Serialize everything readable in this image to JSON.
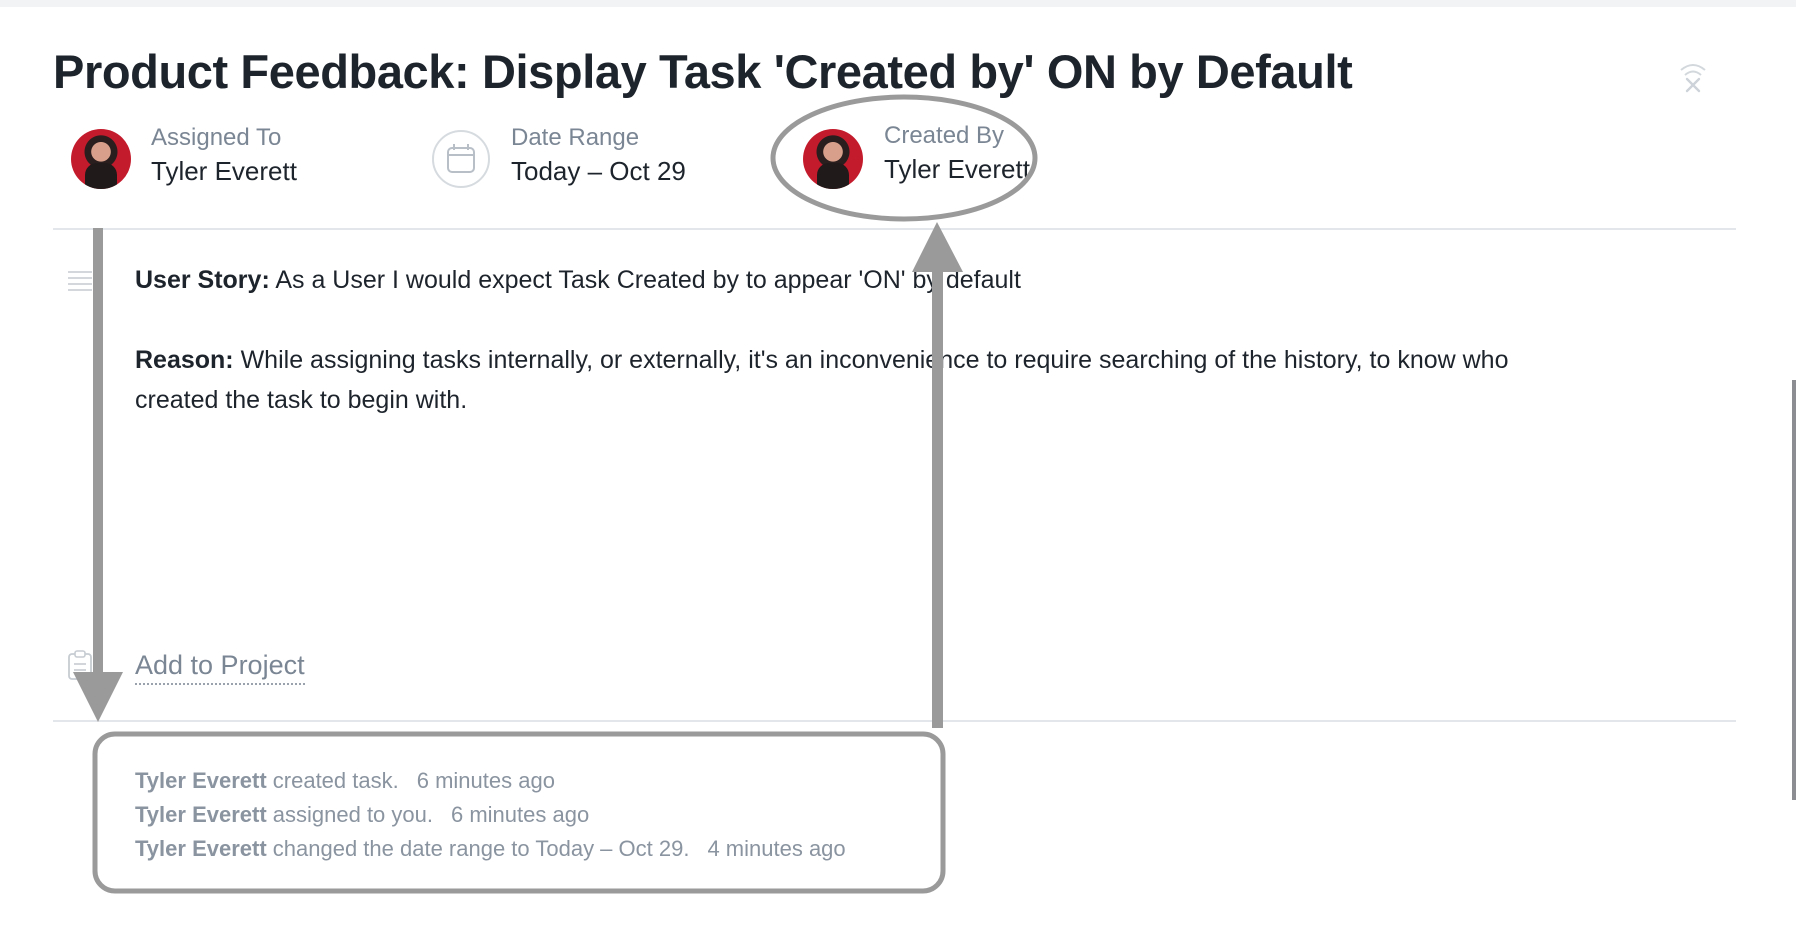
{
  "task": {
    "title": "Product Feedback:  Display Task 'Created by' ON by Default"
  },
  "fields": {
    "assigned_to": {
      "label": "Assigned To",
      "value": "Tyler Everett"
    },
    "date_range": {
      "label": "Date Range",
      "value": "Today – Oct 29"
    },
    "created_by": {
      "label": "Created By",
      "value": "Tyler Everett"
    }
  },
  "description": {
    "story_label": "User Story:",
    "story_text": " As a User I would expect Task Created by to appear 'ON' by default",
    "reason_label": "Reason:",
    "reason_text_1": " While assigning tasks internally, or externally, it's an inconvenience to require searching of the history, to know who",
    "reason_text_2": "created the task to begin with."
  },
  "project": {
    "add_label": "Add to Project"
  },
  "activity": [
    {
      "actor": "Tyler Everett",
      "action": " created task.",
      "time": "6 minutes ago"
    },
    {
      "actor": "Tyler Everett",
      "action": " assigned to you.",
      "time": "6 minutes ago"
    },
    {
      "actor": "Tyler Everett",
      "action": " changed the date range to Today – Oct 29.",
      "time": "4 minutes ago"
    }
  ],
  "icons": {
    "close": "close-icon",
    "calendar": "calendar-icon",
    "description": "description-icon",
    "project": "clipboard-icon"
  },
  "colors": {
    "title": "#1e242c",
    "muted": "#7b8694",
    "annotation": "#9a9a9a",
    "divider": "#e3e6ea"
  }
}
